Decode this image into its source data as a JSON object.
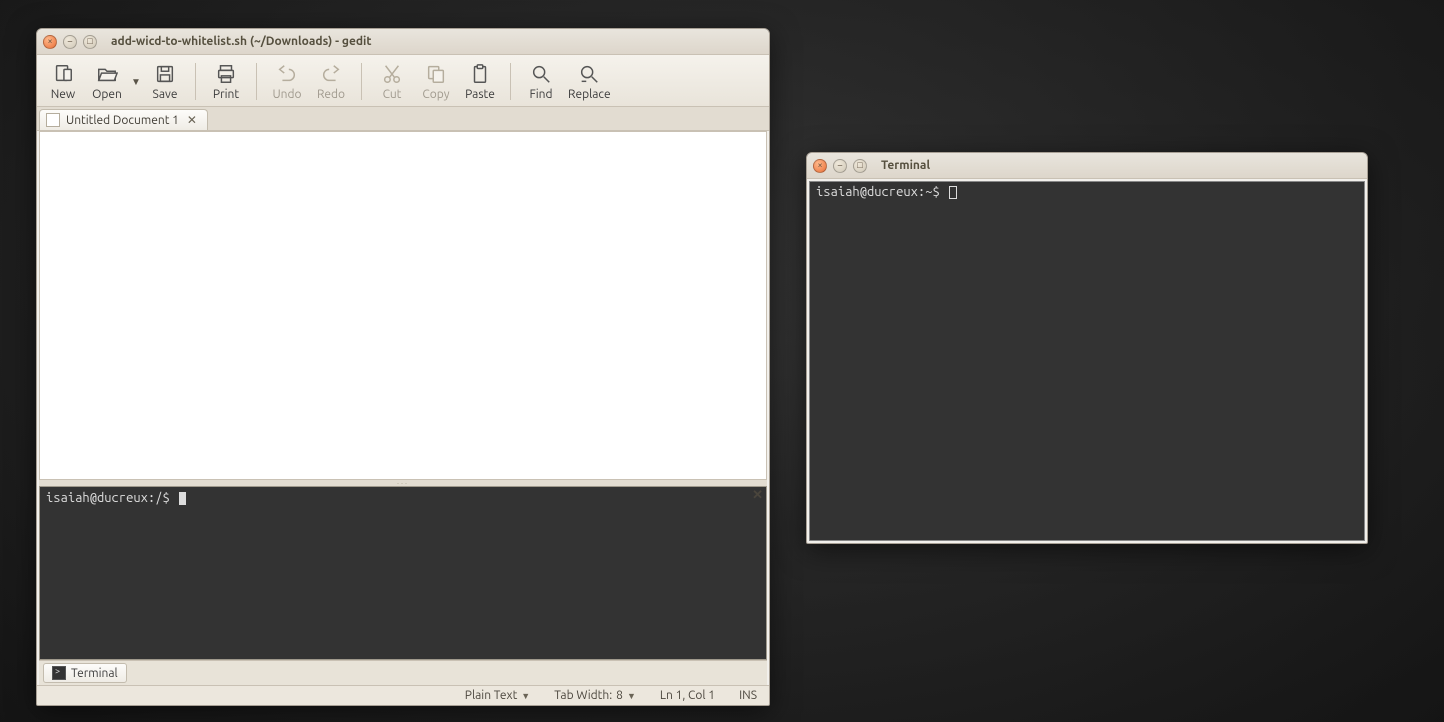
{
  "gedit": {
    "title": "add-wicd-to-whitelist.sh (~/Downloads) - gedit",
    "toolbar": {
      "new": "New",
      "open": "Open",
      "save": "Save",
      "print": "Print",
      "undo": "Undo",
      "redo": "Redo",
      "cut": "Cut",
      "copy": "Copy",
      "paste": "Paste",
      "find": "Find",
      "replace": "Replace"
    },
    "tabs": [
      {
        "label": "Untitled Document 1"
      }
    ],
    "embedded_terminal": {
      "prompt": "isaiah@ducreux:/$ "
    },
    "bottom_tab": "Terminal",
    "status": {
      "syntax": "Plain Text",
      "tab_width_label": "Tab Width:",
      "tab_width_value": "8",
      "position": "Ln 1, Col 1",
      "mode": "INS"
    }
  },
  "terminal": {
    "title": "Terminal",
    "prompt": "isaiah@ducreux:~$ "
  }
}
